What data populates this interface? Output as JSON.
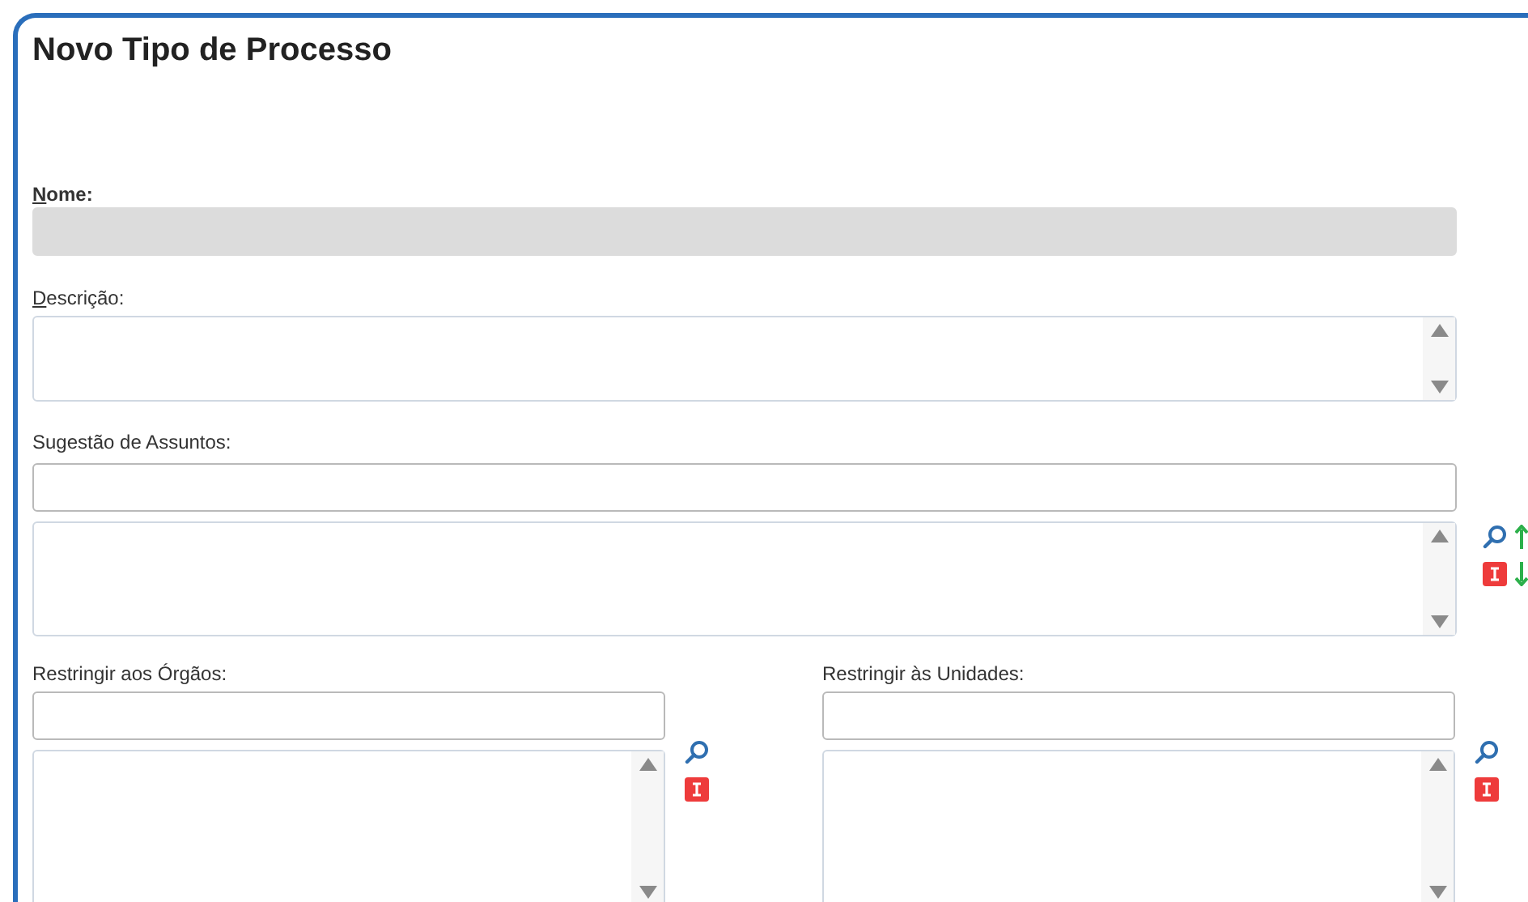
{
  "title": "Novo Tipo de Processo",
  "nome": {
    "label": "Nome:",
    "required": true,
    "accesskey": true,
    "disabled": true
  },
  "descricao": {
    "label": "Descrição:",
    "required": false,
    "accesskey": true
  },
  "sugestao": {
    "label": "Sugestão de Assuntos:",
    "required": false,
    "accesskey": false
  },
  "orgaos": {
    "label": "Restringir aos Órgãos:",
    "required": false,
    "accesskey": false
  },
  "unidades": {
    "label": "Restringir às Unidades:",
    "required": false,
    "accesskey": false
  }
}
